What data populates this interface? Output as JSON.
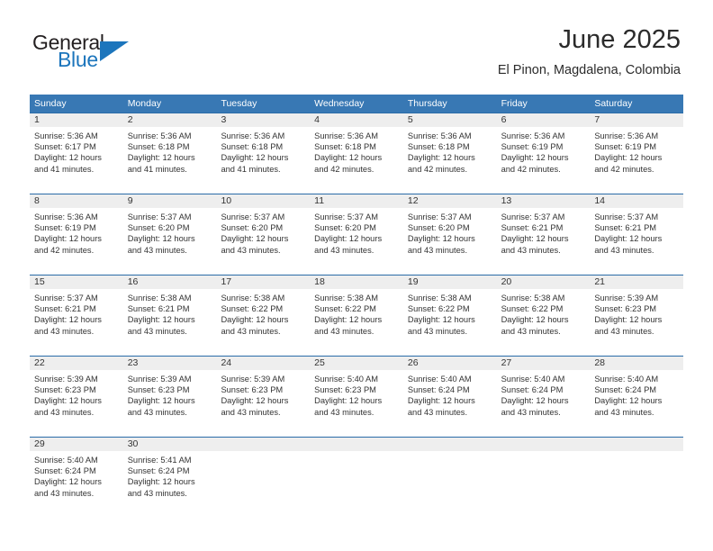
{
  "logo": {
    "word_one": "General",
    "word_two": "Blue",
    "icon": "triangle-logo-icon",
    "accent_color": "#1c75bc"
  },
  "header": {
    "title": "June 2025",
    "location": "El Pinon, Magdalena, Colombia"
  },
  "theme": {
    "header_blue": "#3878b4",
    "row_divider_blue": "#2a6ca8",
    "daynum_band_gray": "#eeeeee"
  },
  "weekdays": [
    "Sunday",
    "Monday",
    "Tuesday",
    "Wednesday",
    "Thursday",
    "Friday",
    "Saturday"
  ],
  "weeks": [
    {
      "days": [
        {
          "num": "1",
          "sunrise": "Sunrise: 5:36 AM",
          "sunset": "Sunset: 6:17 PM",
          "daylight_1": "Daylight: 12 hours",
          "daylight_2": "and 41 minutes."
        },
        {
          "num": "2",
          "sunrise": "Sunrise: 5:36 AM",
          "sunset": "Sunset: 6:18 PM",
          "daylight_1": "Daylight: 12 hours",
          "daylight_2": "and 41 minutes."
        },
        {
          "num": "3",
          "sunrise": "Sunrise: 5:36 AM",
          "sunset": "Sunset: 6:18 PM",
          "daylight_1": "Daylight: 12 hours",
          "daylight_2": "and 41 minutes."
        },
        {
          "num": "4",
          "sunrise": "Sunrise: 5:36 AM",
          "sunset": "Sunset: 6:18 PM",
          "daylight_1": "Daylight: 12 hours",
          "daylight_2": "and 42 minutes."
        },
        {
          "num": "5",
          "sunrise": "Sunrise: 5:36 AM",
          "sunset": "Sunset: 6:18 PM",
          "daylight_1": "Daylight: 12 hours",
          "daylight_2": "and 42 minutes."
        },
        {
          "num": "6",
          "sunrise": "Sunrise: 5:36 AM",
          "sunset": "Sunset: 6:19 PM",
          "daylight_1": "Daylight: 12 hours",
          "daylight_2": "and 42 minutes."
        },
        {
          "num": "7",
          "sunrise": "Sunrise: 5:36 AM",
          "sunset": "Sunset: 6:19 PM",
          "daylight_1": "Daylight: 12 hours",
          "daylight_2": "and 42 minutes."
        }
      ]
    },
    {
      "days": [
        {
          "num": "8",
          "sunrise": "Sunrise: 5:36 AM",
          "sunset": "Sunset: 6:19 PM",
          "daylight_1": "Daylight: 12 hours",
          "daylight_2": "and 42 minutes."
        },
        {
          "num": "9",
          "sunrise": "Sunrise: 5:37 AM",
          "sunset": "Sunset: 6:20 PM",
          "daylight_1": "Daylight: 12 hours",
          "daylight_2": "and 43 minutes."
        },
        {
          "num": "10",
          "sunrise": "Sunrise: 5:37 AM",
          "sunset": "Sunset: 6:20 PM",
          "daylight_1": "Daylight: 12 hours",
          "daylight_2": "and 43 minutes."
        },
        {
          "num": "11",
          "sunrise": "Sunrise: 5:37 AM",
          "sunset": "Sunset: 6:20 PM",
          "daylight_1": "Daylight: 12 hours",
          "daylight_2": "and 43 minutes."
        },
        {
          "num": "12",
          "sunrise": "Sunrise: 5:37 AM",
          "sunset": "Sunset: 6:20 PM",
          "daylight_1": "Daylight: 12 hours",
          "daylight_2": "and 43 minutes."
        },
        {
          "num": "13",
          "sunrise": "Sunrise: 5:37 AM",
          "sunset": "Sunset: 6:21 PM",
          "daylight_1": "Daylight: 12 hours",
          "daylight_2": "and 43 minutes."
        },
        {
          "num": "14",
          "sunrise": "Sunrise: 5:37 AM",
          "sunset": "Sunset: 6:21 PM",
          "daylight_1": "Daylight: 12 hours",
          "daylight_2": "and 43 minutes."
        }
      ]
    },
    {
      "days": [
        {
          "num": "15",
          "sunrise": "Sunrise: 5:37 AM",
          "sunset": "Sunset: 6:21 PM",
          "daylight_1": "Daylight: 12 hours",
          "daylight_2": "and 43 minutes."
        },
        {
          "num": "16",
          "sunrise": "Sunrise: 5:38 AM",
          "sunset": "Sunset: 6:21 PM",
          "daylight_1": "Daylight: 12 hours",
          "daylight_2": "and 43 minutes."
        },
        {
          "num": "17",
          "sunrise": "Sunrise: 5:38 AM",
          "sunset": "Sunset: 6:22 PM",
          "daylight_1": "Daylight: 12 hours",
          "daylight_2": "and 43 minutes."
        },
        {
          "num": "18",
          "sunrise": "Sunrise: 5:38 AM",
          "sunset": "Sunset: 6:22 PM",
          "daylight_1": "Daylight: 12 hours",
          "daylight_2": "and 43 minutes."
        },
        {
          "num": "19",
          "sunrise": "Sunrise: 5:38 AM",
          "sunset": "Sunset: 6:22 PM",
          "daylight_1": "Daylight: 12 hours",
          "daylight_2": "and 43 minutes."
        },
        {
          "num": "20",
          "sunrise": "Sunrise: 5:38 AM",
          "sunset": "Sunset: 6:22 PM",
          "daylight_1": "Daylight: 12 hours",
          "daylight_2": "and 43 minutes."
        },
        {
          "num": "21",
          "sunrise": "Sunrise: 5:39 AM",
          "sunset": "Sunset: 6:23 PM",
          "daylight_1": "Daylight: 12 hours",
          "daylight_2": "and 43 minutes."
        }
      ]
    },
    {
      "days": [
        {
          "num": "22",
          "sunrise": "Sunrise: 5:39 AM",
          "sunset": "Sunset: 6:23 PM",
          "daylight_1": "Daylight: 12 hours",
          "daylight_2": "and 43 minutes."
        },
        {
          "num": "23",
          "sunrise": "Sunrise: 5:39 AM",
          "sunset": "Sunset: 6:23 PM",
          "daylight_1": "Daylight: 12 hours",
          "daylight_2": "and 43 minutes."
        },
        {
          "num": "24",
          "sunrise": "Sunrise: 5:39 AM",
          "sunset": "Sunset: 6:23 PM",
          "daylight_1": "Daylight: 12 hours",
          "daylight_2": "and 43 minutes."
        },
        {
          "num": "25",
          "sunrise": "Sunrise: 5:40 AM",
          "sunset": "Sunset: 6:23 PM",
          "daylight_1": "Daylight: 12 hours",
          "daylight_2": "and 43 minutes."
        },
        {
          "num": "26",
          "sunrise": "Sunrise: 5:40 AM",
          "sunset": "Sunset: 6:24 PM",
          "daylight_1": "Daylight: 12 hours",
          "daylight_2": "and 43 minutes."
        },
        {
          "num": "27",
          "sunrise": "Sunrise: 5:40 AM",
          "sunset": "Sunset: 6:24 PM",
          "daylight_1": "Daylight: 12 hours",
          "daylight_2": "and 43 minutes."
        },
        {
          "num": "28",
          "sunrise": "Sunrise: 5:40 AM",
          "sunset": "Sunset: 6:24 PM",
          "daylight_1": "Daylight: 12 hours",
          "daylight_2": "and 43 minutes."
        }
      ]
    },
    {
      "days": [
        {
          "num": "29",
          "sunrise": "Sunrise: 5:40 AM",
          "sunset": "Sunset: 6:24 PM",
          "daylight_1": "Daylight: 12 hours",
          "daylight_2": "and 43 minutes."
        },
        {
          "num": "30",
          "sunrise": "Sunrise: 5:41 AM",
          "sunset": "Sunset: 6:24 PM",
          "daylight_1": "Daylight: 12 hours",
          "daylight_2": "and 43 minutes."
        },
        {
          "num": "",
          "sunrise": "",
          "sunset": "",
          "daylight_1": "",
          "daylight_2": ""
        },
        {
          "num": "",
          "sunrise": "",
          "sunset": "",
          "daylight_1": "",
          "daylight_2": ""
        },
        {
          "num": "",
          "sunrise": "",
          "sunset": "",
          "daylight_1": "",
          "daylight_2": ""
        },
        {
          "num": "",
          "sunrise": "",
          "sunset": "",
          "daylight_1": "",
          "daylight_2": ""
        },
        {
          "num": "",
          "sunrise": "",
          "sunset": "",
          "daylight_1": "",
          "daylight_2": ""
        }
      ]
    }
  ]
}
